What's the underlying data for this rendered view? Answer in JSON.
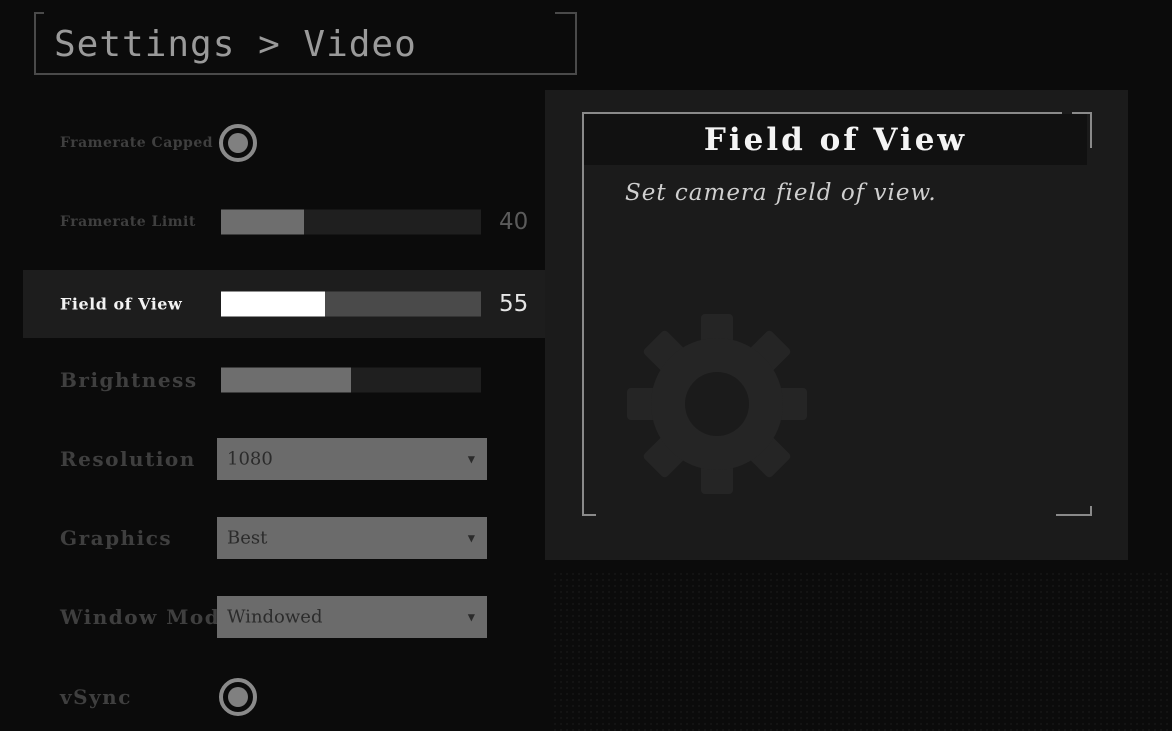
{
  "page": {
    "title": "Settings > Video"
  },
  "settings": {
    "framerate_capped": {
      "label": "Framerate Capped",
      "enabled": true
    },
    "framerate_limit": {
      "label": "Framerate Limit",
      "value": "40",
      "fill": 0.32
    },
    "field_of_view": {
      "label": "Field of View",
      "value": "55",
      "fill": 0.4
    },
    "brightness": {
      "label": "Brightness",
      "fill": 0.5
    },
    "resolution": {
      "label": "Resolution",
      "selected": "1080"
    },
    "graphics": {
      "label": "Graphics",
      "selected": "Best"
    },
    "window_mode": {
      "label": "Window Mode",
      "selected": "Windowed"
    },
    "vsync": {
      "label": "vSync",
      "enabled": true
    }
  },
  "info_panel": {
    "heading": "Field of View",
    "description": "Set camera field of view.",
    "icon": "gear-icon"
  },
  "colors": {
    "background": "#0b0b0b",
    "active_row": "#1d1d1d",
    "panel": "#1b1b1b",
    "slider_fill_active": "#ffffff",
    "dropdown": "#6b6b6b"
  }
}
